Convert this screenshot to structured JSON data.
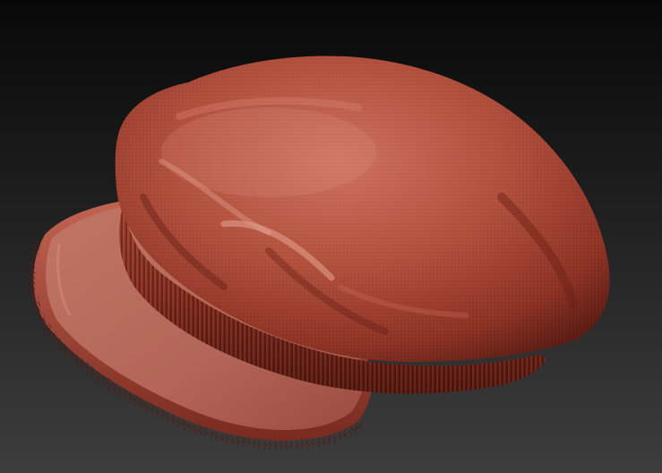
{
  "scene": {
    "subject_icon": "newsboy-cap-3d-sculpt",
    "colors": {
      "background_top": "#080808",
      "background_bottom": "#3d3d3d",
      "material_base": "#a0402e",
      "material_highlight": "#d37a66",
      "material_shadow": "#4a1510",
      "brim_top": "#b9685a"
    }
  }
}
